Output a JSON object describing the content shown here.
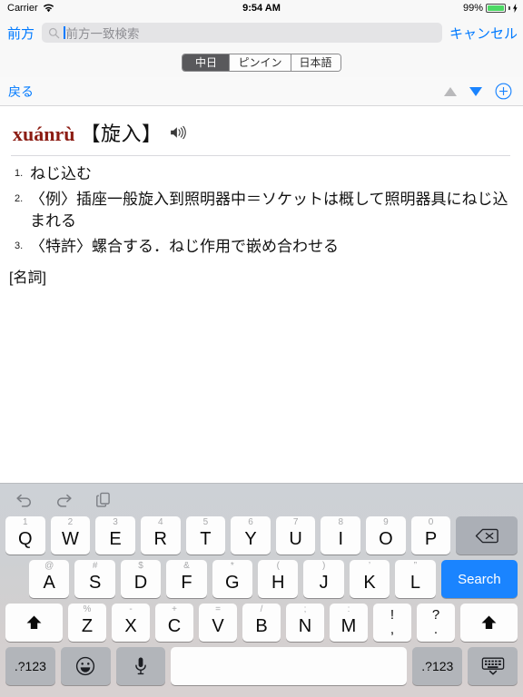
{
  "statusbar": {
    "carrier": "Carrier",
    "time": "9:54 AM",
    "battery": "99%"
  },
  "searchbar": {
    "prefix_button": "前方",
    "placeholder": "前方一致検索",
    "value": "",
    "cancel": "キャンセル"
  },
  "segmented": {
    "options": [
      {
        "label": "中日",
        "selected": true
      },
      {
        "label": "ピンイン",
        "selected": false
      },
      {
        "label": "日本語",
        "selected": false
      }
    ]
  },
  "navbar": {
    "back": "戻る",
    "prev_icon": "triangle-up-icon",
    "next_icon": "triangle-down-icon",
    "add_icon": "plus-circle-icon",
    "prev_color": "#b9b9bb",
    "next_color": "#1a84ff"
  },
  "entry": {
    "pinyin": "xuánrù",
    "headword": "【旋入】",
    "audio_icon": "speaker-icon",
    "pinyin_color": "#8c1c13",
    "senses": [
      {
        "num": "1.",
        "text": "ねじ込む"
      },
      {
        "num": "2.",
        "text": "〈例〉插座一般旋入到照明器中＝ソケットは概して照明器具にねじ込まれる"
      },
      {
        "num": "3.",
        "text": "〈特許〉螺合する．ねじ作用で嵌め合わせる"
      }
    ],
    "pos": "[名詞]"
  },
  "keyboard": {
    "toolbar": [
      {
        "name": "undo-icon"
      },
      {
        "name": "redo-icon"
      },
      {
        "name": "paste-icon"
      }
    ],
    "row1": [
      {
        "alt": "1",
        "main": "Q"
      },
      {
        "alt": "2",
        "main": "W"
      },
      {
        "alt": "3",
        "main": "E"
      },
      {
        "alt": "4",
        "main": "R"
      },
      {
        "alt": "5",
        "main": "T"
      },
      {
        "alt": "6",
        "main": "Y"
      },
      {
        "alt": "7",
        "main": "U"
      },
      {
        "alt": "8",
        "main": "I"
      },
      {
        "alt": "9",
        "main": "O"
      },
      {
        "alt": "0",
        "main": "P"
      }
    ],
    "backspace_icon": "backspace-icon",
    "row2": [
      {
        "alt": "@",
        "main": "A"
      },
      {
        "alt": "#",
        "main": "S"
      },
      {
        "alt": "$",
        "main": "D"
      },
      {
        "alt": "&",
        "main": "F"
      },
      {
        "alt": "*",
        "main": "G"
      },
      {
        "alt": "(",
        "main": "H"
      },
      {
        "alt": ")",
        "main": "J"
      },
      {
        "alt": "’",
        "main": "K"
      },
      {
        "alt": "”",
        "main": "L"
      }
    ],
    "search_key": "Search",
    "row3": [
      {
        "alt": "%",
        "main": "Z"
      },
      {
        "alt": "-",
        "main": "X"
      },
      {
        "alt": "+",
        "main": "C"
      },
      {
        "alt": "=",
        "main": "V"
      },
      {
        "alt": "/",
        "main": "B"
      },
      {
        "alt": ";",
        "main": "N"
      },
      {
        "alt": ":",
        "main": "M"
      }
    ],
    "punct1": {
      "top": "!",
      "bot": ","
    },
    "punct2": {
      "top": "?",
      "bot": "."
    },
    "shift_left_icon": "shift-up-arrow-icon",
    "shift_right_icon": "shift-up-arrow-icon",
    "row4": {
      "numeric_left": ".?123",
      "emoji_icon": "emoji-smiley-icon",
      "mic_icon": "microphone-icon",
      "space": "",
      "numeric_right": ".?123",
      "dismiss_icon": "keyboard-dismiss-icon"
    }
  }
}
